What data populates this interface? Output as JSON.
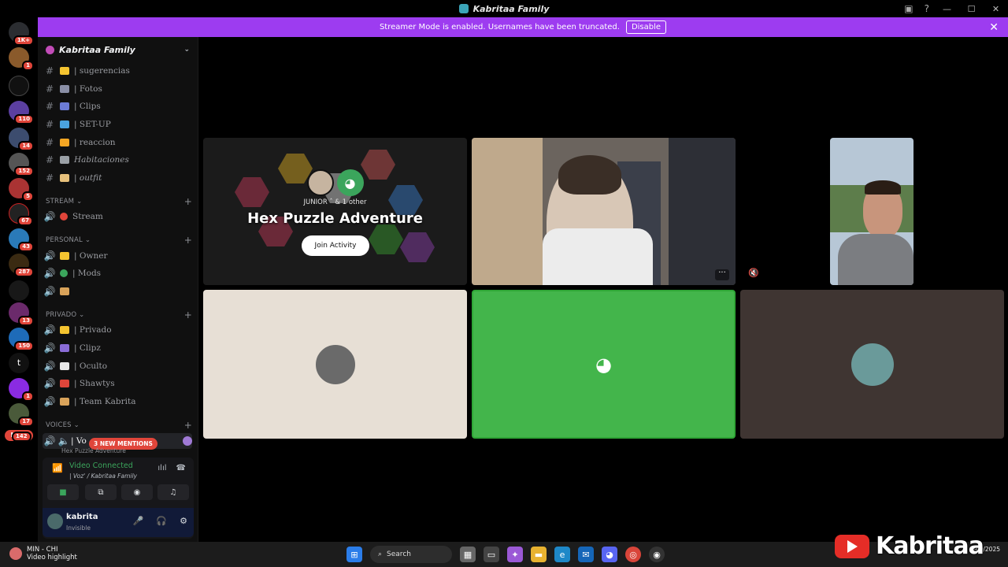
{
  "window": {
    "title": "Kabritaa Family"
  },
  "banner": {
    "message": "Streamer Mode is enabled. Usernames have been truncated.",
    "disable_label": "Disable"
  },
  "rail": {
    "badges": [
      "1K+",
      "1",
      "110",
      "14",
      "152",
      "5",
      "67",
      "43",
      "287",
      "13",
      "150",
      "1",
      "17",
      "142"
    ],
    "letters": [
      "t"
    ],
    "new_label": "NEW"
  },
  "sidebar": {
    "guild_name": "Kabritaa Family",
    "text_channels": [
      {
        "name": "| sugerencias",
        "emoji_color": "#f4c430",
        "italic": false
      },
      {
        "name": "| Fotos",
        "emoji_color": "#8a8fa6",
        "italic": false
      },
      {
        "name": "| Clips",
        "emoji_color": "#6c7cd6",
        "italic": false
      },
      {
        "name": "| SET-UP",
        "emoji_color": "#4aa3df",
        "italic": false
      },
      {
        "name": "| reaccion",
        "emoji_color": "#f5a623",
        "italic": false
      },
      {
        "name": "Habitaciones",
        "emoji_color": "#9aa0a6",
        "italic": true
      },
      {
        "name": "| outfit",
        "emoji_color": "#e6c07b",
        "italic": true
      }
    ],
    "categories": {
      "stream": "STREAM",
      "personal": "PERSONAL",
      "privado": "PRIVADO",
      "voices": "VOICES"
    },
    "stream_channels": [
      {
        "name": "Stream",
        "emoji_color": "#e0453a"
      }
    ],
    "personal_channels": [
      {
        "name": "| Owner",
        "emoji_color": "#f4c430"
      },
      {
        "name": "| Mods",
        "emoji_color": "#3ba55c"
      },
      {
        "name": "",
        "emoji_color": "#d9a35a"
      }
    ],
    "privado_channels": [
      {
        "name": "| Privado",
        "emoji_color": "#f4c430"
      },
      {
        "name": "| Clipz",
        "emoji_color": "#8a6cd6"
      },
      {
        "name": "| Oculto",
        "emoji_color": "#e6e6e6"
      },
      {
        "name": "| Shawtys",
        "emoji_color": "#e0453a"
      },
      {
        "name": "| Team Kabrita",
        "emoji_color": "#d9a35a"
      }
    ],
    "voice_channel": {
      "name": "| Vo",
      "activity": "Hex Puzzle Adventure"
    },
    "mentions_label": "3 NEW MENTIONS"
  },
  "voice_panel": {
    "status": "Video Connected",
    "location": "| Voz' / Kabritaa Family"
  },
  "user": {
    "name": "kabrita",
    "status": "Invisible"
  },
  "activity": {
    "host_line": "JUNIOR ˆ  & 1 other",
    "name": "Hex Puzzle Adventure",
    "join_label": "Join Activity"
  },
  "taskbar": {
    "widget_title": "MIN - CHI",
    "widget_sub": "Video highlight",
    "search_placeholder": "Search",
    "date": "9/9/2025"
  },
  "watermark": {
    "text": "Kabritaa"
  }
}
